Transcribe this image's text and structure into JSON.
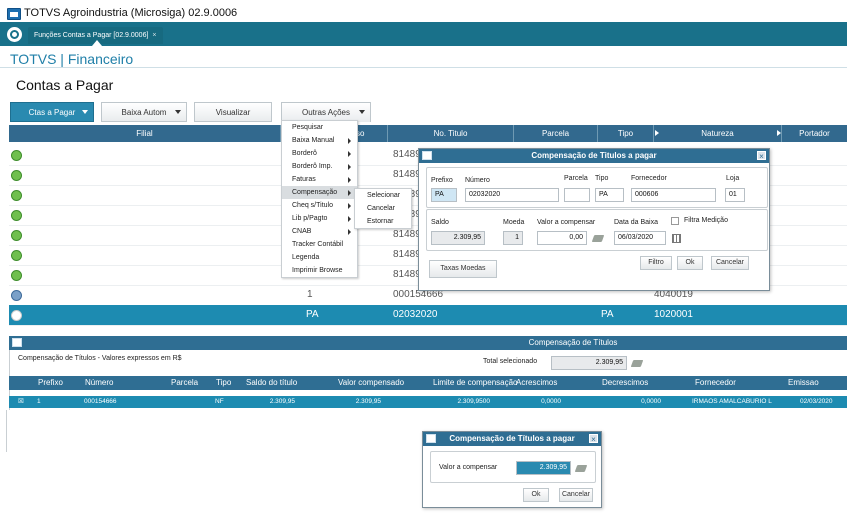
{
  "window": {
    "title": "TOTVS Agroindustria (Microsiga) 02.9.0006"
  },
  "tab": {
    "label": "Funções Contas a Pagar [02.9.0006]",
    "close": "×"
  },
  "module": {
    "title": "TOTVS | Financeiro"
  },
  "page": {
    "title": "Contas a Pagar"
  },
  "toolbar": {
    "ctas_label": "Ctas a Pagar",
    "baixa_label": "Baixa Autom",
    "visualizar_label": "Visualizar",
    "outras_label": "Outras Ações"
  },
  "grid": {
    "columns": [
      "Filial",
      "so",
      "No. Titulo",
      "Parcela",
      "Tipo",
      "Natureza",
      "Portador"
    ],
    "rows": [
      {
        "c1": "",
        "c2": "81489"
      },
      {
        "c1": "",
        "c2": "81489"
      },
      {
        "c1": "",
        "c2": "81489"
      },
      {
        "c1": "",
        "c2": "81489"
      },
      {
        "c1": "",
        "c2": "81489"
      },
      {
        "c1": "",
        "c2": "81489"
      },
      {
        "c1": "",
        "c2": "81489"
      },
      {
        "c1": "1",
        "c2": "000154666",
        "nat": "4040019"
      }
    ],
    "selected": {
      "prefixo": "PA",
      "titulo": "02032020",
      "tipo": "PA",
      "natureza": "1020001"
    }
  },
  "menu": {
    "items": [
      "Pesquisar",
      "Baixa Manual",
      "Borderô",
      "Borderô Imp.",
      "Faturas",
      "Compensação",
      "Cheq s/Titulo",
      "Lib p/Pagto",
      "CNAB",
      "Tracker Contábil",
      "Legenda",
      "Imprimir Browse"
    ],
    "submenu": [
      "Selecionar",
      "Cancelar",
      "Estornar"
    ]
  },
  "dialog1": {
    "title": "Compensação de Titulos a pagar",
    "labels": {
      "prefixo": "Prefixo",
      "numero": "Número",
      "parcela": "Parcela",
      "tipo": "Tipo",
      "fornecedor": "Fornecedor",
      "loja": "Loja",
      "saldo": "Saldo",
      "moeda": "Moeda",
      "valor": "Valor a compensar",
      "data": "Data da Baixa",
      "filtra": "Filtra Medição"
    },
    "values": {
      "prefixo": "PA",
      "numero": "02032020",
      "parcela": "",
      "tipo": "PA",
      "fornecedor": "000606",
      "loja": "01",
      "saldo": "2.309,95",
      "moeda": "1",
      "valor": "0,00",
      "data": "06/03/2020"
    },
    "buttons": {
      "taxas": "Taxas Moedas",
      "filtro": "Filtro",
      "ok": "Ok",
      "cancelar": "Cancelar"
    }
  },
  "panel": {
    "title": "Compensação de Títulos",
    "subtitle": "Compensação de Títulos - Valores expressos em R$",
    "total_label": "Total selecionado",
    "total_value": "2.309,95",
    "columns": [
      "Prefixo",
      "Número",
      "Parcela",
      "Tipo",
      "Saldo do título",
      "Valor compensado",
      "Limite de compensação",
      "Acrescimos",
      "Decrescimos",
      "Fornecedor",
      "Emissao"
    ],
    "row": {
      "check": "☒",
      "prefixo": "1",
      "numero": "000154666",
      "parcela": "",
      "tipo": "NF",
      "saldo": "2.309,95",
      "valor": "2.309,95",
      "limite": "2.309,9500",
      "acresc": "0,0000",
      "decresc": "0,0000",
      "fornecedor": "IRMAOS AMALCABURIO L",
      "emissao": "02/03/2020"
    }
  },
  "dialog2": {
    "title": "Compensação de Títulos a pagar",
    "label": "Valor a compensar",
    "value": "2.309,95",
    "ok": "Ok",
    "cancelar": "Cancelar"
  },
  "colors": {
    "teal": "#19718a",
    "header": "#32698e",
    "selected": "#1d8bb1",
    "dialog": "#2f6e93"
  }
}
